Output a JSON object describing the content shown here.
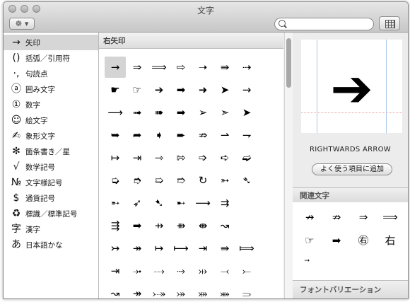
{
  "window": {
    "title": "文字"
  },
  "toolbar": {
    "gear_label": "☸ ▾",
    "search_placeholder": "",
    "search_value": ""
  },
  "sidebar": {
    "items": [
      {
        "icon": "→",
        "label": "矢印",
        "selected": true
      },
      {
        "icon": "()",
        "label": "括弧／引用符"
      },
      {
        "icon": "·,",
        "label": "句読点"
      },
      {
        "icon": "ⓐ",
        "label": "囲み文字"
      },
      {
        "icon": "①",
        "label": "数字"
      },
      {
        "icon": "☺",
        "label": "絵文字"
      },
      {
        "icon": "✍",
        "label": "象形文字"
      },
      {
        "icon": "✻",
        "label": "箇条書き／星"
      },
      {
        "icon": "√",
        "label": "数学記号"
      },
      {
        "icon": "№",
        "label": "文字様記号"
      },
      {
        "icon": "$",
        "label": "通貨記号"
      },
      {
        "icon": "♻",
        "label": "標識／標準記号"
      },
      {
        "icon": "字",
        "label": "漢字"
      },
      {
        "icon": "あ",
        "label": "日本語かな"
      }
    ]
  },
  "grid": {
    "header": "右矢印",
    "rows": [
      [
        "→",
        "⇒",
        "⟹",
        "⇨",
        "➝",
        "⇛",
        "⇢",
        "",
        ""
      ],
      [
        "☛",
        "☞",
        "➔",
        "➡",
        "➜",
        "➤",
        "→",
        "",
        ""
      ],
      [
        "⟶",
        "➟",
        "➠",
        "➡",
        "➢",
        "➣",
        "➤",
        "",
        ""
      ],
      [
        "➥",
        "➦",
        "➧",
        "➨",
        "⇏",
        "⇀",
        "⇁",
        "",
        ""
      ],
      [
        "↦",
        "⇥",
        "⇾",
        "⇰",
        "➩",
        "➪",
        "➫",
        "",
        ""
      ],
      [
        "➭",
        "➮",
        "➯",
        "➱",
        "↻",
        "➳",
        "➴",
        "",
        ""
      ],
      [
        "➵",
        "➶",
        "➷",
        "➸",
        "⟶",
        "⇉",
        "",
        ""
      ],
      [
        "⇶",
        "➡",
        "⇸",
        "⇻",
        "⇼",
        "↝",
        "",
        ""
      ],
      [
        "↣",
        "↠",
        "↦",
        "⟼",
        "⇥",
        "⇛",
        "⟾",
        "",
        ""
      ],
      [
        "⇥",
        "⤞",
        "⤏",
        "⤑",
        "⤔",
        "⤙",
        "⤚",
        "",
        ""
      ],
      [
        "↝",
        "↠",
        "⤐",
        "⤖",
        "⤗",
        "⤘",
        "⥰",
        "",
        ""
      ]
    ]
  },
  "preview": {
    "glyph": "➔",
    "name": "RIGHTWARDS ARROW",
    "add_favorite_label": "よく使う項目に追加"
  },
  "related": {
    "header": "関連文字",
    "items": [
      "↛",
      "⇏",
      "⇒",
      "⟹",
      "☞",
      "➡",
      "㊨",
      "右",
      "⃗"
    ]
  },
  "variation": {
    "header": "フォントバリエーション"
  }
}
